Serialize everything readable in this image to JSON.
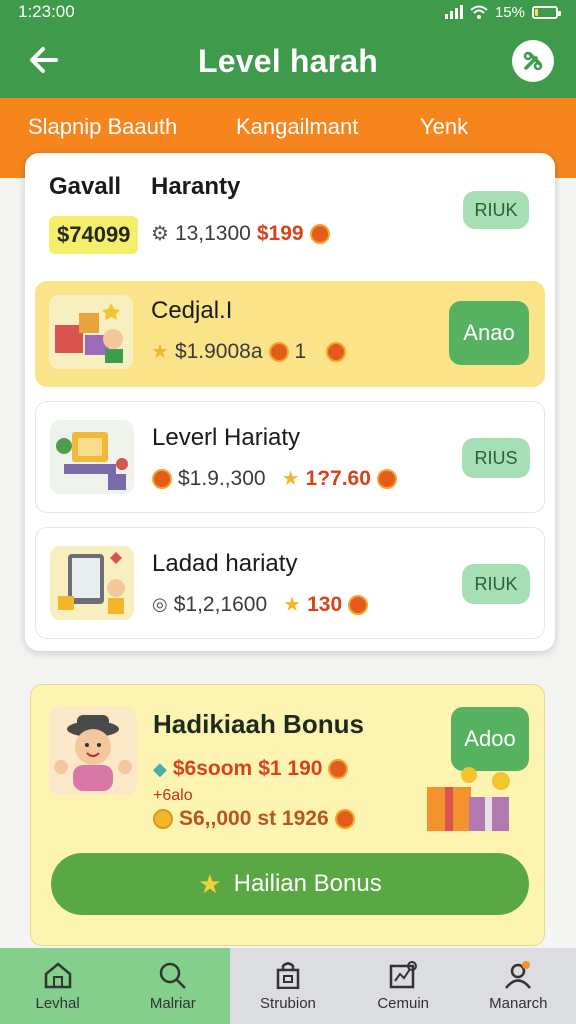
{
  "status": {
    "time": "1:23:00",
    "battery": "15%",
    "battery_level": 0.15
  },
  "header": {
    "title": "Level harah",
    "back_icon": "arrow-left-icon",
    "tool_icon": "wrench-icon"
  },
  "tabs": [
    {
      "label": "Slapnip Baauth"
    },
    {
      "label": "Kangailmant"
    },
    {
      "label": "Yenk"
    }
  ],
  "summary": {
    "title_a": "Gavall",
    "title_b": "Haranty",
    "amount": "$74099",
    "stat": "13,1300",
    "price": "$199",
    "button": "RIUK"
  },
  "items": [
    {
      "title": "Cedjal.I",
      "stat": "$1.9008a",
      "value": "1",
      "button": "Anao",
      "highlight": true
    },
    {
      "title": "Leverl Hariaty",
      "stat": "$1.9.,300",
      "value": "1?7.60",
      "button": "RIUS",
      "highlight": false
    },
    {
      "title": "Ladad hariaty",
      "stat": "$1,2,1600",
      "value": "130",
      "button": "RIUK",
      "highlight": false
    }
  ],
  "bonus": {
    "title": "Hadikiaah Bonus",
    "line1_amount": "$6soom",
    "line1_value": "$1 190",
    "sub_label": "+6alo",
    "line2_amount": "S6,,000",
    "line2_value": "st 1926",
    "button": "Adoo",
    "cta": "Hailian Bonus"
  },
  "nav": [
    {
      "label": "Levhal",
      "icon": "home-icon",
      "active": true
    },
    {
      "label": "Malriar",
      "icon": "search-icon",
      "active": true
    },
    {
      "label": "Strubion",
      "icon": "bag-icon",
      "active": false
    },
    {
      "label": "Cemuin",
      "icon": "chart-icon",
      "active": false
    },
    {
      "label": "Manarch",
      "icon": "profile-icon",
      "active": false
    }
  ],
  "colors": {
    "primary_green": "#3f9a4c",
    "tab_orange": "#f6851e",
    "highlight_yellow": "#fbe38a",
    "bonus_yellow": "#fdf4b2",
    "button_green": "#5aa843",
    "nav_active": "#84cf8c"
  }
}
